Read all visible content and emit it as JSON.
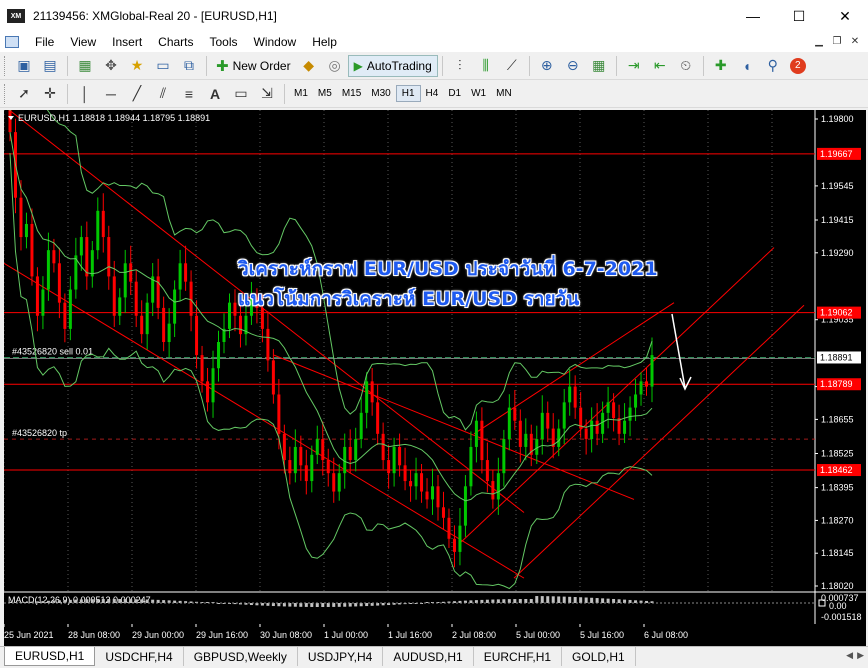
{
  "window": {
    "title": "21139456: XMGlobal-Real 20 - [EURUSD,H1]",
    "app_icon_label": "XM",
    "minimize": "—",
    "maximize": "☐",
    "close": "✕"
  },
  "menu": [
    "File",
    "View",
    "Insert",
    "Charts",
    "Tools",
    "Window",
    "Help"
  ],
  "toolbar": {
    "new_order_label": "New Order",
    "autotrading_label": "AutoTrading",
    "notification_count": "2"
  },
  "timeframes": [
    "M1",
    "M5",
    "M15",
    "M30",
    "H1",
    "H4",
    "D1",
    "W1",
    "MN"
  ],
  "active_timeframe": "H1",
  "chart": {
    "header": "EURUSD,H1  1.18818 1.18944 1.18795 1.18891",
    "overlay_line1": "วิเคราะห์กราฟ EUR/USD ประจำวันที่ 6-7-2021",
    "overlay_line2": "แนวโน้มการวิเคราะห์ EUR/USD  รายวัน",
    "sell_label": "#43526820 sell 0.01",
    "tp_label": "#43526820 tp",
    "macd_label": "MACD(12,26,9) 0.000512 0.000247",
    "bid_price": "1.18891",
    "colors": {
      "bull": "#00c800",
      "bear": "#ff0000",
      "hline": "#ff0000",
      "price_tag": "#ff0000",
      "bid_tag": "#ffffff",
      "sell_line": "#2e8b57",
      "bands": "#64c864",
      "overlay_text": "#1e5af0"
    }
  },
  "price_axis": {
    "ticks": [
      "1.19800",
      "1.19545",
      "1.19415",
      "1.19290",
      "1.19035",
      "1.18780",
      "1.18655",
      "1.18525",
      "1.18395",
      "1.18270",
      "1.18145",
      "1.18020"
    ],
    "tags": [
      "1.19667",
      "1.19062",
      "1.18789",
      "1.18462"
    ],
    "macd_ticks": [
      "0.000737",
      "0.00",
      "-0.001518"
    ]
  },
  "time_axis": [
    "25 Jun 2021",
    "28 Jun 08:00",
    "29 Jun 00:00",
    "29 Jun 16:00",
    "30 Jun 08:00",
    "1 Jul 00:00",
    "1 Jul 16:00",
    "2 Jul 08:00",
    "5 Jul 00:00",
    "5 Jul 16:00",
    "6 Jul 08:00"
  ],
  "tabs": [
    "EURUSD,H1",
    "USDCHF,H4",
    "GBPUSD,Weekly",
    "USDJPY,H4",
    "AUDUSD,H1",
    "EURCHF,H1",
    "GOLD,H1"
  ],
  "active_tab": "EURUSD,H1",
  "tab_scroll": [
    "◀",
    "▶"
  ]
}
